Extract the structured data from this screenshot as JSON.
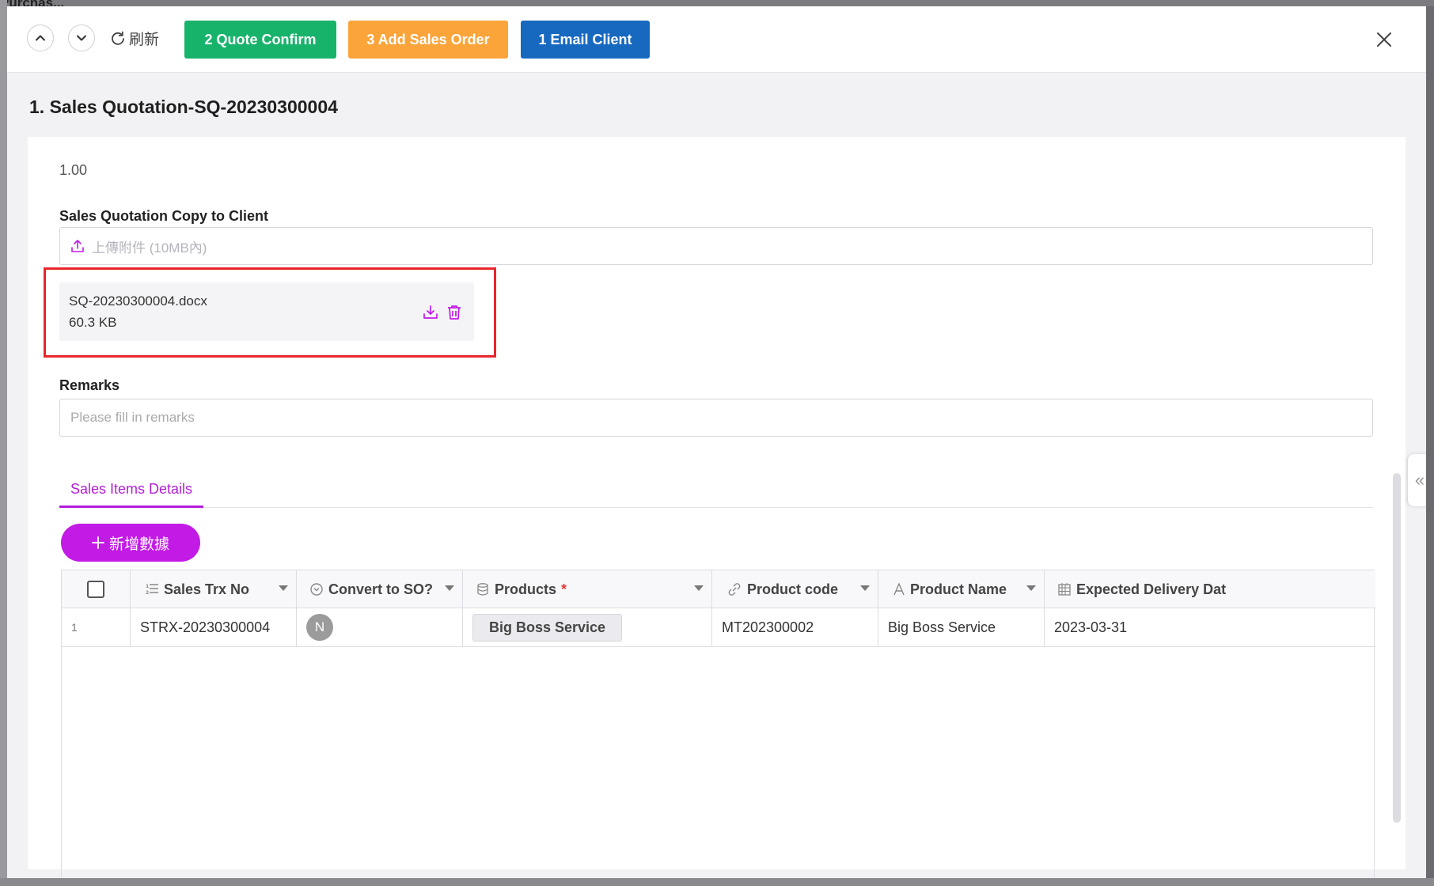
{
  "background": {
    "top_label": "Purchas..."
  },
  "toolbar": {
    "refresh_label": "刷新",
    "quote_confirm_label": "2 Quote Confirm",
    "add_sales_order_label": "3 Add Sales Order",
    "email_client_label": "1 Email Client"
  },
  "colors": {
    "quote_confirm": "#18b36b",
    "add_sales_order": "#fba43a",
    "email_client": "#1769c0",
    "accent": "#c21be6",
    "highlight_border": "#e8262d"
  },
  "record": {
    "title": "1. Sales Quotation-SQ-20230300004"
  },
  "form": {
    "amount_value": "1.00",
    "copy_to_client_label": "Sales Quotation Copy to Client",
    "upload_placeholder": "上傳附件 (10MB內)",
    "attachment": {
      "file_name": "SQ-20230300004.docx",
      "file_size": "60.3 KB"
    },
    "remarks_label": "Remarks",
    "remarks_placeholder": "Please fill in remarks"
  },
  "tabs": [
    {
      "label": "Sales Items Details",
      "active": true
    }
  ],
  "add_row_label": "新增數據",
  "table": {
    "columns": [
      {
        "label": "Sales Trx No",
        "icon": "numbered-list-icon"
      },
      {
        "label": "Convert to SO?",
        "icon": "option-circle-icon"
      },
      {
        "label": "Products",
        "icon": "database-icon",
        "required": true
      },
      {
        "label": "Product code",
        "icon": "link-icon"
      },
      {
        "label": "Product Name",
        "icon": "text-a-icon"
      },
      {
        "label": "Expected Delivery Dat",
        "icon": "calendar-icon"
      }
    ],
    "rows": [
      {
        "index": "1",
        "sales_trx_no": "STRX-20230300004",
        "convert_to_so": "N",
        "product": "Big Boss Service",
        "product_code": "MT202300002",
        "product_name": "Big Boss Service",
        "expected_delivery": "2023-03-31"
      }
    ]
  }
}
